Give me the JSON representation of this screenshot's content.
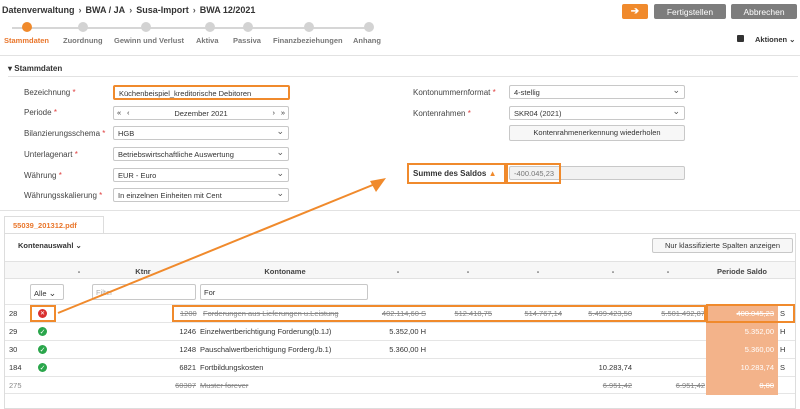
{
  "breadcrumb": {
    "items": [
      "Datenverwaltung",
      "BWA / JA",
      "Susa-Import",
      "BWA 12/2021"
    ]
  },
  "toolbar": {
    "next_label": "➔",
    "finish_label": "Fertigstellen",
    "cancel_label": "Abbrechen",
    "actions_label": "Aktionen ⌄"
  },
  "steps": [
    {
      "label": "Stammdaten",
      "active": true
    },
    {
      "label": "Zuordnung"
    },
    {
      "label": "Gewinn und Verlust"
    },
    {
      "label": "Aktiva"
    },
    {
      "label": "Passiva"
    },
    {
      "label": "Finanzbeziehungen"
    },
    {
      "label": "Anhang"
    }
  ],
  "section": {
    "title": "Stammdaten"
  },
  "form": {
    "bezeichnung": {
      "label": "Bezeichnung",
      "value": "Küchenbeispiel_kreditorische Debitoren"
    },
    "periode": {
      "label": "Periode",
      "value": "Dezember 2021"
    },
    "bilanzierungsschema": {
      "label": "Bilanzierungsschema",
      "value": "HGB"
    },
    "unterlagenart": {
      "label": "Unterlagenart",
      "value": "Betriebswirtschaftliche Auswertung"
    },
    "waehrung": {
      "label": "Währung",
      "value": "EUR - Euro"
    },
    "skalierung": {
      "label": "Währungsskalierung",
      "value": "In einzelnen Einheiten mit Cent"
    },
    "kontonummernformat": {
      "label": "Kontonummernformat",
      "value": "4-stellig"
    },
    "kontenrahmen": {
      "label": "Kontenrahmen",
      "value": "SKR04 (2021)"
    },
    "kontenrahmen_button": "Kontenrahmenerkennung wiederholen",
    "summe": {
      "label": "Summe des Saldos",
      "value": "-400.045,23"
    }
  },
  "file_tab": "55039_201312.pdf",
  "table": {
    "auswahl_label": "Kontenauswahl ⌄",
    "nur_button": "Nur klassifizierte Spalten anzeigen",
    "headers": [
      "-",
      "Ktnr",
      "Kontoname",
      "-",
      "-",
      "-",
      "-",
      "-",
      "Periode Saldo"
    ],
    "filter": {
      "alle": "Alle",
      "ktnr_placeholder": "Filter",
      "name_placeholder": "For"
    },
    "rows": [
      {
        "id": "28",
        "status": "error",
        "ktnr": "1200",
        "name": "Forderungen aus Lieferungen u.Leistung",
        "c1": "402.114,60 S",
        "c2": "512.418,75",
        "c3": "514.767,14",
        "c4": "5.499.423,50",
        "c5": "5.501.492,87",
        "saldo": "400.045,23",
        "sh": "S",
        "struck": true
      },
      {
        "id": "29",
        "status": "ok",
        "ktnr": "1246",
        "name": "Einzelwertberichtigung Forderung(b.1J)",
        "c1": "5.352,00 H",
        "c2": "",
        "c3": "",
        "c4": "",
        "c5": "",
        "saldo": "5.352,00",
        "sh": "H",
        "struck": false
      },
      {
        "id": "30",
        "status": "ok",
        "ktnr": "1248",
        "name": "Pauschalwertberichtigung Forderg./b.1)",
        "c1": "5.360,00 H",
        "c2": "",
        "c3": "",
        "c4": "",
        "c5": "",
        "saldo": "5.360,00",
        "sh": "H",
        "struck": false
      },
      {
        "id": "184",
        "status": "ok",
        "ktnr": "6821",
        "name": "Fortbildungskosten",
        "c1": "",
        "c2": "",
        "c3": "",
        "c4": "10.283,74",
        "c5": "",
        "saldo": "10.283,74",
        "sh": "S",
        "struck": false
      },
      {
        "id": "275",
        "status": "none",
        "ktnr": "60307",
        "name": "Muster forever",
        "c1": "",
        "c2": "",
        "c3": "",
        "c4": "6.951,42",
        "c5": "6.951,42",
        "saldo": "0,00",
        "sh": "",
        "struck": true
      }
    ]
  }
}
